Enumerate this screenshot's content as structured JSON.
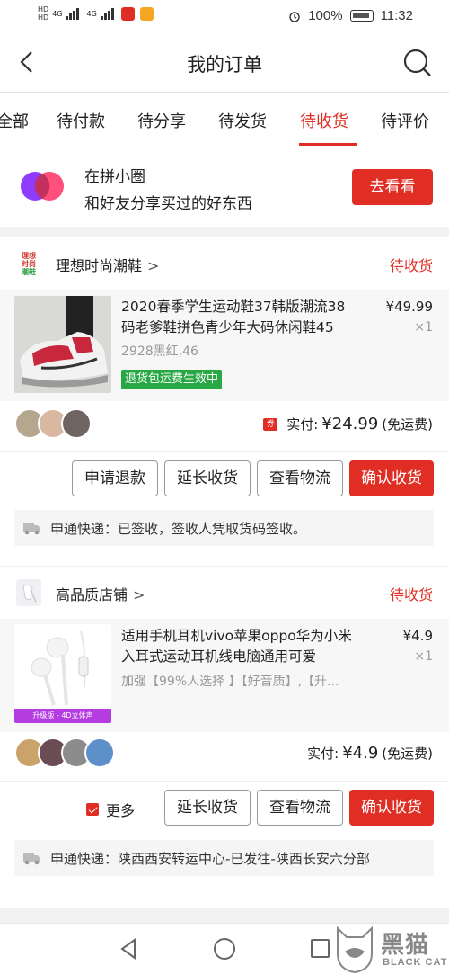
{
  "status_bar": {
    "network_1": "4G",
    "network_2": "4G",
    "battery": "100%",
    "time": "11:32"
  },
  "header": {
    "title": "我的订单"
  },
  "tabs": [
    {
      "label": "全部"
    },
    {
      "label": "待付款"
    },
    {
      "label": "待分享"
    },
    {
      "label": "待发货"
    },
    {
      "label": "待收货",
      "active": true
    },
    {
      "label": "待评价"
    }
  ],
  "promo": {
    "line1": "在拼小圈",
    "line2": "和好友分享买过的好东西",
    "button": "去看看"
  },
  "orders": [
    {
      "shop_logo_text": "理想时尚潮鞋",
      "shop_name": "理想时尚潮鞋",
      "chevron": ">",
      "status": "待收货",
      "product": {
        "title_line1": "2020春季学生运动鞋37韩版潮流38",
        "title_line2": "码老爹鞋拼色青少年大码休闲鞋45",
        "price": "¥49.99",
        "qty": "×1",
        "spec": "2928黑红,46",
        "tag": "退货包运费生效中"
      },
      "coupon_icon": "券",
      "paid_label": "实付:",
      "paid_amount": "¥24.99",
      "paid_note": "(免运费)",
      "buttons": [
        "申请退款",
        "延长收货",
        "查看物流",
        "确认收货"
      ],
      "logistics": "申通快递：已签收，签收人凭取货码签收。"
    },
    {
      "shop_name": "高品质店铺",
      "chevron": ">",
      "status": "待收货",
      "product": {
        "title_line1": "适用手机耳机vivo苹果oppo华为小米",
        "title_line2": "入耳式运动耳机线电脑通用可爱",
        "price": "¥4.9",
        "qty": "×1",
        "spec": "加强【99%人选择 】【好音质】,【升...",
        "thumb_label": "升级版 - 4D立体声"
      },
      "paid_label": "实付:",
      "paid_amount": "¥4.9",
      "paid_note": "(免运费)",
      "more_label": "更多",
      "buttons": [
        "延长收货",
        "查看物流",
        "确认收货"
      ],
      "logistics": "申通快递：陕西西安转运中心-已发往-陕西长安六分部"
    }
  ],
  "watermark": {
    "cn": "黑猫",
    "en": "BLACK CAT"
  },
  "colors": {
    "accent": "#e02e24",
    "green": "#27a844"
  }
}
